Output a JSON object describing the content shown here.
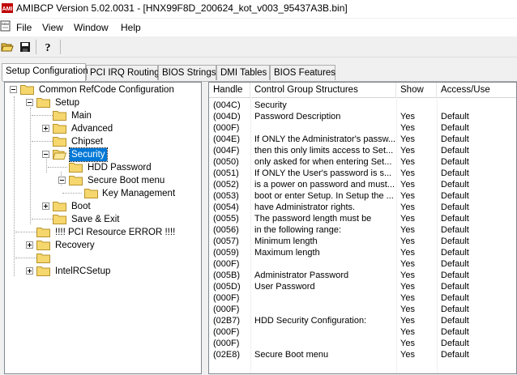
{
  "window": {
    "title": "AMIBCP Version 5.02.0031 - [HNX99F8D_200624_kot_v003_95437A3B.bin]"
  },
  "menu": {
    "items": [
      "File",
      "View",
      "Window",
      "Help"
    ]
  },
  "tabs": [
    "Setup Configuration",
    "PCI IRQ Routing",
    "BIOS Strings",
    "DMI Tables",
    "BIOS Features"
  ],
  "tree": {
    "root": "Common RefCode Configuration",
    "setup": "Setup",
    "main": "Main",
    "advanced": "Advanced",
    "chipset": "Chipset",
    "security": "Security",
    "hdd_password": "HDD Password",
    "secure_boot_menu": "Secure Boot menu",
    "key_management": "Key Management",
    "boot": "Boot",
    "save_exit": "Save & Exit",
    "pci_error": "!!!! PCI Resource ERROR !!!!",
    "recovery": "Recovery",
    "blank": "",
    "intel_rc": "IntelRCSetup"
  },
  "grid": {
    "columns": [
      "Handle",
      "Control Group Structures",
      "Show",
      "Access/Use"
    ],
    "rows": [
      [
        "(004C)",
        "Security",
        "",
        ""
      ],
      [
        "(004D)",
        "Password Description",
        "Yes",
        "Default"
      ],
      [
        "(000F)",
        "",
        "Yes",
        "Default"
      ],
      [
        "(004E)",
        "If ONLY the Administrator's passw...",
        "Yes",
        "Default"
      ],
      [
        "(004F)",
        "then this only limits access to Set...",
        "Yes",
        "Default"
      ],
      [
        "(0050)",
        "only asked for when entering Set...",
        "Yes",
        "Default"
      ],
      [
        "(0051)",
        "If ONLY the User's password is s...",
        "Yes",
        "Default"
      ],
      [
        "(0052)",
        "is a power on password and must...",
        "Yes",
        "Default"
      ],
      [
        "(0053)",
        "boot or enter Setup. In Setup the ...",
        "Yes",
        "Default"
      ],
      [
        "(0054)",
        "have Administrator rights.",
        "Yes",
        "Default"
      ],
      [
        "(0055)",
        "The password length must be",
        "Yes",
        "Default"
      ],
      [
        "(0056)",
        "in the following range:",
        "Yes",
        "Default"
      ],
      [
        "(0057)",
        "Minimum length",
        "Yes",
        "Default"
      ],
      [
        "(0059)",
        "Maximum length",
        "Yes",
        "Default"
      ],
      [
        "(000F)",
        "",
        "Yes",
        "Default"
      ],
      [
        "(005B)",
        "Administrator Password",
        "Yes",
        "Default"
      ],
      [
        "(005D)",
        "User Password",
        "Yes",
        "Default"
      ],
      [
        "(000F)",
        "",
        "Yes",
        "Default"
      ],
      [
        "(000F)",
        "",
        "Yes",
        "Default"
      ],
      [
        "(02B7)",
        "HDD Security Configuration:",
        "Yes",
        "Default"
      ],
      [
        "(000F)",
        "",
        "Yes",
        "Default"
      ],
      [
        "(000F)",
        "",
        "Yes",
        "Default"
      ],
      [
        "(02E8)",
        "Secure Boot menu",
        "Yes",
        "Default"
      ]
    ]
  }
}
